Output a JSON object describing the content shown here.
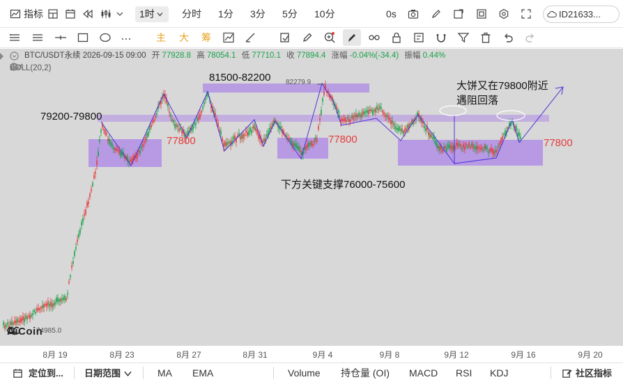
{
  "toolbar": {
    "indicator_label": "指标",
    "active_timeframe": "1时",
    "timeframes": [
      "分时",
      "1分",
      "3分",
      "5分",
      "10分"
    ],
    "zero_s_label": "0s",
    "account_id": "ID21633..."
  },
  "drawbar": {
    "main_label": "主",
    "big_label": "大",
    "chips_label": "筹"
  },
  "info": {
    "symbol": "BTC/USDT永续",
    "datetime": "2026-09-15 09:00",
    "open_label": "开",
    "open": "77928.8",
    "high_label": "高",
    "high": "78054.1",
    "low_label": "低",
    "low": "77710.1",
    "close_label": "收",
    "close": "77894.4",
    "change_label": "涨幅",
    "change": "-0.04%(-34.4)",
    "amplitude_label": "振幅",
    "amplitude": "0.44%",
    "boll": "BOLL(20,2)"
  },
  "annotations": {
    "zone_left": "79200-79800",
    "zone_top": "81500-82200",
    "peak_price": "82279.9",
    "resistance_note_line1": "大饼又在79800附近",
    "resistance_note_line2": "遇阻回落",
    "support_a": "77800",
    "support_b": "77800",
    "support_c": "77800",
    "key_support": "下方关键支撑76000-75600",
    "low_price": "74985.0"
  },
  "logo": "AiCoin",
  "x_axis": [
    "8月 19",
    "8月 23",
    "8月 27",
    "8月 31",
    "9月 4",
    "9月 8",
    "9月 12",
    "9月 16",
    "9月 20"
  ],
  "bottombar": {
    "locate": "定位到...",
    "date_range": "日期范围",
    "indicators": [
      "MA",
      "EMA",
      "Volume",
      "持仓量 (OI)",
      "MACD",
      "RSI",
      "KDJ"
    ],
    "community": "社区指标"
  },
  "colors": {
    "up": "#1aa34a",
    "down": "#e43c3c",
    "zone_fill": "#b28ee6",
    "trend_line": "#4b34d6",
    "chart_bg": "#d8d8d8"
  }
}
